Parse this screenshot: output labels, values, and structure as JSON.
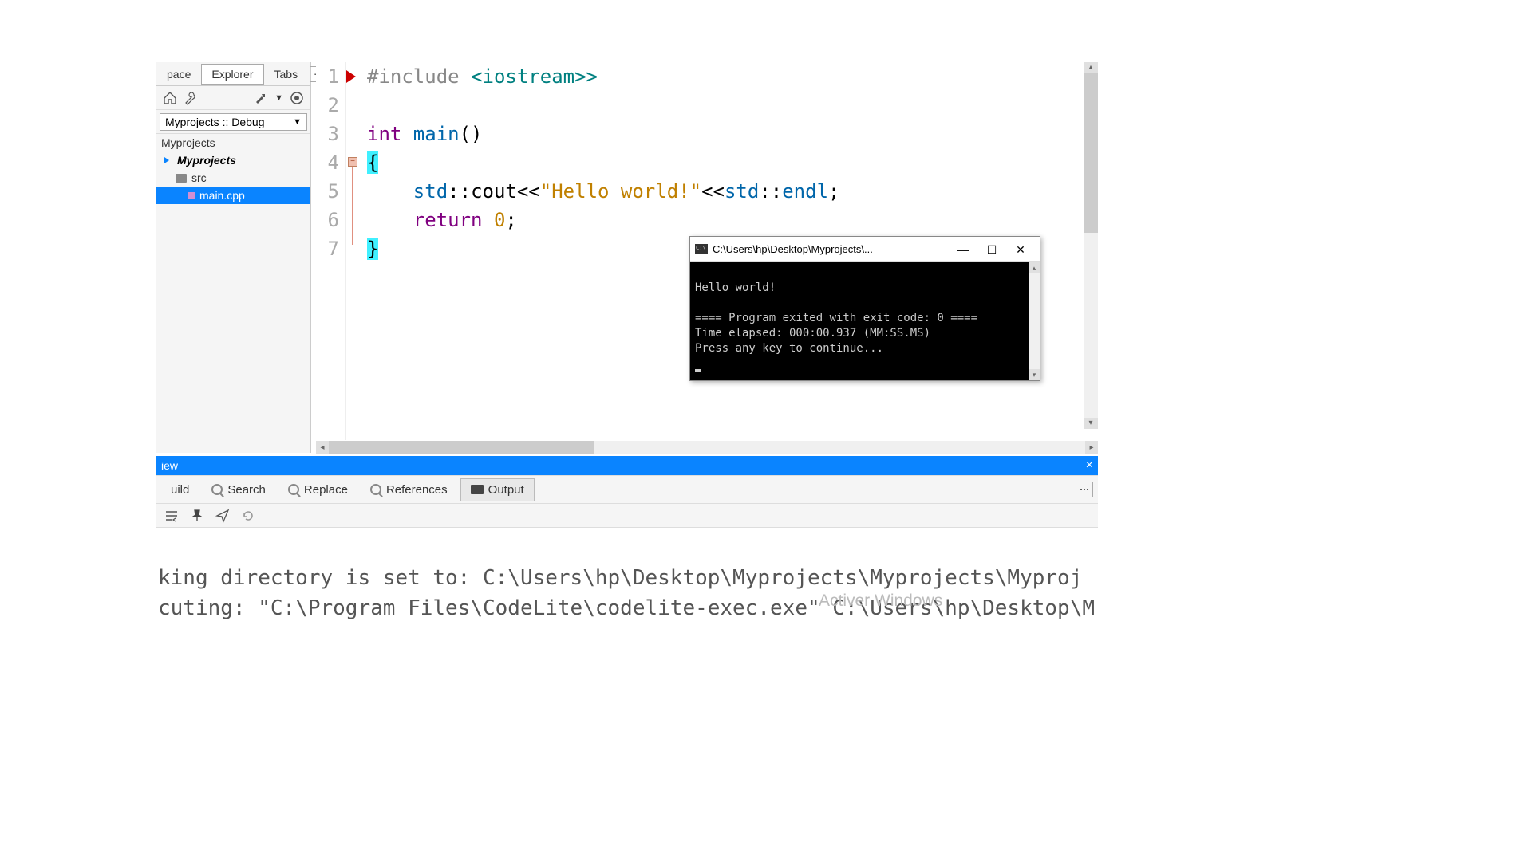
{
  "side_tabs": {
    "t0": "pace",
    "t1": "Explorer",
    "t2": "Tabs",
    "more": "⋯"
  },
  "toolbar": {},
  "config": {
    "label": "Myprojects :: Debug"
  },
  "tree": {
    "root": "Myprojects",
    "project": "Myprojects",
    "folder": "src",
    "file": "main.cpp"
  },
  "gutter": {
    "l1": "1",
    "l2": "2",
    "l3": "3",
    "l4": "4",
    "l5": "5",
    "l6": "6",
    "l7": "7"
  },
  "code": {
    "l1_pp": "#include ",
    "l1_inc": "<iostream>",
    "l1_extra": ">",
    "l3_type": "int ",
    "l3_fn": "main",
    "l3_par": "()",
    "l4_brace": "{",
    "l5_indent": "    ",
    "l5_ns1": "std",
    "l5_op1": "::",
    "l5_cout": "cout",
    "l5_op2": "<<",
    "l5_str": "\"Hello world!\"",
    "l5_op3": "<<",
    "l5_ns2": "std",
    "l5_op4": "::",
    "l5_endl": "endl",
    "l5_semi": ";",
    "l6_indent": "    ",
    "l6_ret": "return ",
    "l6_num": "0",
    "l6_semi": ";",
    "l7_brace": "}"
  },
  "view_bar": {
    "label": "iew"
  },
  "bottom_tabs": {
    "t0": "uild",
    "t1": "Search",
    "t2": "Replace",
    "t3": "References",
    "t4": "Output",
    "more": "⋯"
  },
  "output": {
    "l1": "king directory is set to: C:\\Users\\hp\\Desktop\\Myprojects\\Myprojects\\Myproj",
    "l2": "cuting: \"C:\\Program Files\\CodeLite\\codelite-exec.exe\" C:\\Users\\hp\\Desktop\\M"
  },
  "watermark": "Activer Windows",
  "console": {
    "title": "C:\\Users\\hp\\Desktop\\Myprojects\\...",
    "l1": "Hello world!",
    "l2": "",
    "l3": "==== Program exited with exit code: 0 ====",
    "l4": "Time elapsed: 000:00.937 (MM:SS.MS)",
    "l5": "Press any key to continue..."
  }
}
